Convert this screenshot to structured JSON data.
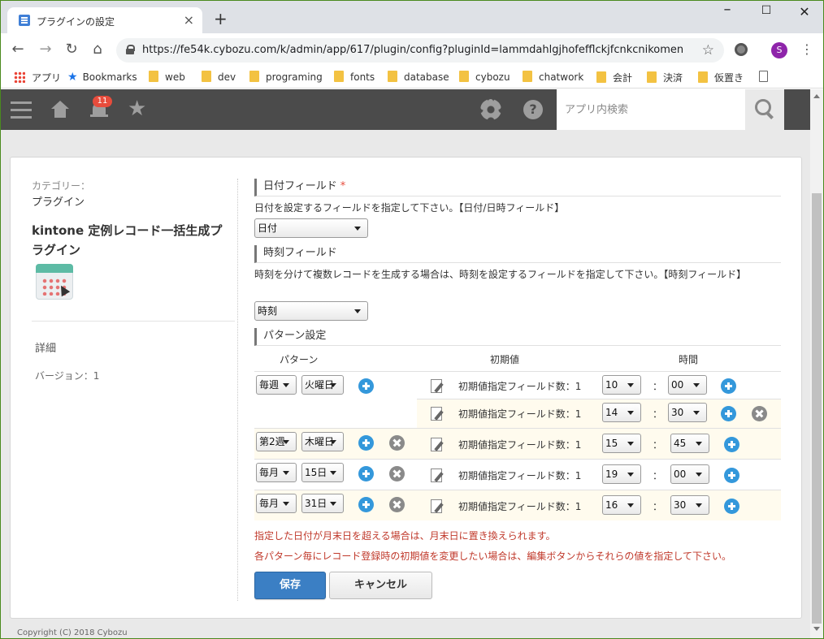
{
  "browser": {
    "tab_title": "プラグインの設定",
    "url": "https://fe54k.cybozu.com/k/admin/app/617/plugin/config?pluginId=lammdahlgjhofefflckjfcnkcnikomen",
    "avatar_letter": "S",
    "bookmarks": [
      "アプリ",
      "Bookmarks",
      "web",
      "dev",
      "programing",
      "fonts",
      "database",
      "cybozu",
      "chatwork",
      "会計",
      "決済",
      "仮置き"
    ]
  },
  "header": {
    "notification_count": "11",
    "search_placeholder": "アプリ内検索"
  },
  "sidebar": {
    "category_label": "カテゴリー：",
    "category_value": "プラグイン",
    "plugin_name": "kintone 定例レコード一括生成プラグイン",
    "detail_label": "詳細",
    "version_label": "バージョン：1"
  },
  "date_section": {
    "title": "日付フィールド",
    "required_mark": "*",
    "description": "日付を設定するフィールドを指定して下さい。【日付/日時フィールド】",
    "selected": "日付"
  },
  "time_section": {
    "title": "時刻フィールド",
    "description": "時刻を分けて複数レコードを生成する場合は、時刻を設定するフィールドを指定して下さい。【時刻フィールド】",
    "selected": "時刻"
  },
  "pattern_section": {
    "title": "パターン設定",
    "columns": [
      "パターン",
      "初期値",
      "時間"
    ],
    "init_label": "初期値指定フィールド数：1",
    "colon": "：",
    "rows": [
      {
        "p1": "毎週",
        "p2": "火曜日",
        "hour": "10",
        "minute": "00"
      },
      {
        "hour": "14",
        "minute": "30"
      },
      {
        "p1": "第2週",
        "p2": "木曜日",
        "hour": "15",
        "minute": "45"
      },
      {
        "p1": "毎月",
        "p2": "15日",
        "hour": "19",
        "minute": "00"
      },
      {
        "p1": "毎月",
        "p2": "31日",
        "hour": "16",
        "minute": "30"
      }
    ]
  },
  "notes": [
    "指定した日付が月末日を超える場合は、月末日に置き換えられます。",
    "各パターン毎にレコード登録時の初期値を変更したい場合は、編集ボタンからそれらの値を指定して下さい。"
  ],
  "buttons": {
    "save": "保存",
    "cancel": "キャンセル"
  },
  "footer": "Copyright (C) 2018 Cybozu"
}
